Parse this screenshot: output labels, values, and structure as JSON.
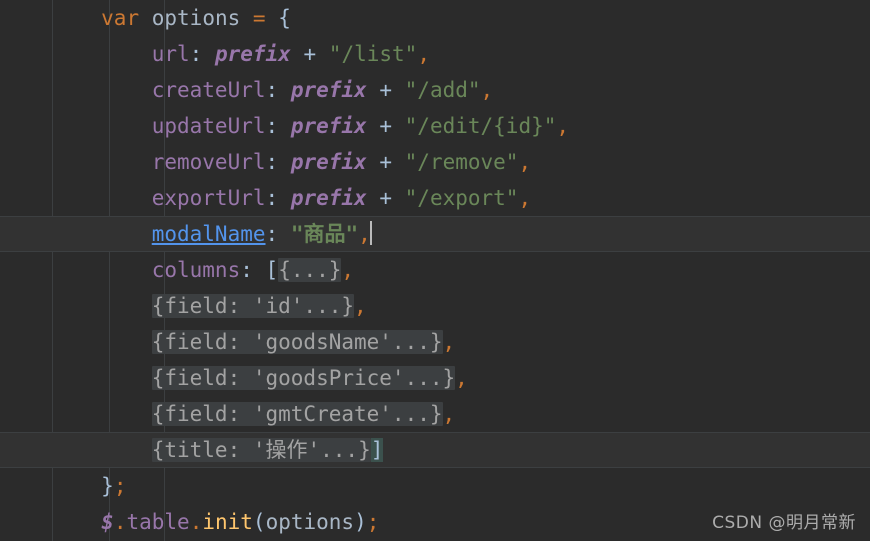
{
  "editor": {
    "background_color": "#2b2b2b",
    "current_line_color": "#323232",
    "fold_background_color": "#3c3f41",
    "indent_guide_color": "#3c3f41",
    "font_size_px": 21,
    "line_height_px": 36,
    "indent_guides_x": [
      52,
      109,
      164
    ]
  },
  "colors": {
    "keyword": "#cc7832",
    "default_text": "#a9b7c6",
    "property": "#9876aa",
    "string": "#6a8759",
    "function": "#ffc66d",
    "punctuation": "#cc7832",
    "brace": "#a9c0d8",
    "linked_identifier": "#5394ec",
    "folded_text": "#a3a3a3",
    "caret": "#bbbbbb"
  },
  "code": {
    "lines": [
      {
        "id": "line-var-options",
        "indent": "        ",
        "highlighted": false,
        "tokens": [
          {
            "text": "var",
            "type": "keyword"
          },
          {
            "text": " ",
            "type": "default"
          },
          {
            "text": "options",
            "type": "default"
          },
          {
            "text": " ",
            "type": "default"
          },
          {
            "text": "=",
            "type": "punct"
          },
          {
            "text": " ",
            "type": "default"
          },
          {
            "text": "{",
            "type": "brace"
          }
        ]
      },
      {
        "id": "line-url",
        "indent": "            ",
        "highlighted": false,
        "tokens": [
          {
            "text": "url",
            "type": "prop"
          },
          {
            "text": ":",
            "type": "colon"
          },
          {
            "text": " ",
            "type": "default"
          },
          {
            "text": "prefix",
            "type": "field"
          },
          {
            "text": " ",
            "type": "default"
          },
          {
            "text": "+",
            "type": "brace"
          },
          {
            "text": " ",
            "type": "default"
          },
          {
            "text": "\"/list\"",
            "type": "string"
          },
          {
            "text": ",",
            "type": "punct"
          }
        ]
      },
      {
        "id": "line-createurl",
        "indent": "            ",
        "highlighted": false,
        "tokens": [
          {
            "text": "createUrl",
            "type": "prop"
          },
          {
            "text": ":",
            "type": "colon"
          },
          {
            "text": " ",
            "type": "default"
          },
          {
            "text": "prefix",
            "type": "field"
          },
          {
            "text": " ",
            "type": "default"
          },
          {
            "text": "+",
            "type": "brace"
          },
          {
            "text": " ",
            "type": "default"
          },
          {
            "text": "\"/add\"",
            "type": "string"
          },
          {
            "text": ",",
            "type": "punct"
          }
        ]
      },
      {
        "id": "line-updateurl",
        "indent": "            ",
        "highlighted": false,
        "tokens": [
          {
            "text": "updateUrl",
            "type": "prop"
          },
          {
            "text": ":",
            "type": "colon"
          },
          {
            "text": " ",
            "type": "default"
          },
          {
            "text": "prefix",
            "type": "field"
          },
          {
            "text": " ",
            "type": "default"
          },
          {
            "text": "+",
            "type": "brace"
          },
          {
            "text": " ",
            "type": "default"
          },
          {
            "text": "\"/edit/{id}\"",
            "type": "string"
          },
          {
            "text": ",",
            "type": "punct"
          }
        ]
      },
      {
        "id": "line-removeurl",
        "indent": "            ",
        "highlighted": false,
        "tokens": [
          {
            "text": "removeUrl",
            "type": "prop"
          },
          {
            "text": ":",
            "type": "colon"
          },
          {
            "text": " ",
            "type": "default"
          },
          {
            "text": "prefix",
            "type": "field"
          },
          {
            "text": " ",
            "type": "default"
          },
          {
            "text": "+",
            "type": "brace"
          },
          {
            "text": " ",
            "type": "default"
          },
          {
            "text": "\"/remove\"",
            "type": "string"
          },
          {
            "text": ",",
            "type": "punct"
          }
        ]
      },
      {
        "id": "line-exporturl",
        "indent": "            ",
        "highlighted": false,
        "tokens": [
          {
            "text": "exportUrl",
            "type": "prop"
          },
          {
            "text": ":",
            "type": "colon"
          },
          {
            "text": " ",
            "type": "default"
          },
          {
            "text": "prefix",
            "type": "field"
          },
          {
            "text": " ",
            "type": "default"
          },
          {
            "text": "+",
            "type": "brace"
          },
          {
            "text": " ",
            "type": "default"
          },
          {
            "text": "\"/export\"",
            "type": "string"
          },
          {
            "text": ",",
            "type": "punct"
          }
        ]
      },
      {
        "id": "line-modalname",
        "indent": "            ",
        "highlighted": true,
        "tokens": [
          {
            "text": "modalName",
            "type": "link"
          },
          {
            "text": ":",
            "type": "colon"
          },
          {
            "text": " ",
            "type": "default"
          },
          {
            "text": "\"商品\"",
            "type": "string-b"
          },
          {
            "text": ",",
            "type": "punct"
          },
          {
            "text": "",
            "type": "caret"
          }
        ]
      },
      {
        "id": "line-columns",
        "indent": "            ",
        "highlighted": false,
        "tokens": [
          {
            "text": "columns",
            "type": "prop"
          },
          {
            "text": ":",
            "type": "colon"
          },
          {
            "text": " ",
            "type": "default"
          },
          {
            "text": "[",
            "type": "brace"
          },
          {
            "text": "{...}",
            "type": "fold"
          },
          {
            "text": ",",
            "type": "punct"
          }
        ]
      },
      {
        "id": "line-field-id",
        "indent": "            ",
        "highlighted": false,
        "tokens": [
          {
            "text": "{field: 'id'...}",
            "type": "fold"
          },
          {
            "text": ",",
            "type": "punct"
          }
        ]
      },
      {
        "id": "line-field-goodsname",
        "indent": "            ",
        "highlighted": false,
        "tokens": [
          {
            "text": "{field: 'goodsName'...}",
            "type": "fold"
          },
          {
            "text": ",",
            "type": "punct"
          }
        ]
      },
      {
        "id": "line-field-goodsprice",
        "indent": "            ",
        "highlighted": false,
        "tokens": [
          {
            "text": "{field: 'goodsPrice'...}",
            "type": "fold"
          },
          {
            "text": ",",
            "type": "punct"
          }
        ]
      },
      {
        "id": "line-field-gmtcreate",
        "indent": "            ",
        "highlighted": false,
        "tokens": [
          {
            "text": "{field: 'gmtCreate'...}",
            "type": "fold"
          },
          {
            "text": ",",
            "type": "punct"
          }
        ]
      },
      {
        "id": "line-title-caozuo",
        "indent": "            ",
        "highlighted": true,
        "tokens": [
          {
            "text": "{title: '操作'...}",
            "type": "fold"
          },
          {
            "text": "]",
            "type": "brace-match"
          }
        ]
      },
      {
        "id": "line-close-brace",
        "indent": "        ",
        "highlighted": false,
        "tokens": [
          {
            "text": "}",
            "type": "brace"
          },
          {
            "text": ";",
            "type": "punct"
          }
        ]
      },
      {
        "id": "line-table-init",
        "indent": "        ",
        "highlighted": false,
        "tokens": [
          {
            "text": "$",
            "type": "dollar"
          },
          {
            "text": ".",
            "type": "punct"
          },
          {
            "text": "table",
            "type": "prop"
          },
          {
            "text": ".",
            "type": "punct"
          },
          {
            "text": "init",
            "type": "func"
          },
          {
            "text": "(",
            "type": "brace"
          },
          {
            "text": "options",
            "type": "default"
          },
          {
            "text": ")",
            "type": "brace"
          },
          {
            "text": ";",
            "type": "punct"
          }
        ]
      }
    ]
  },
  "watermark": {
    "text": "CSDN @明月常新"
  }
}
